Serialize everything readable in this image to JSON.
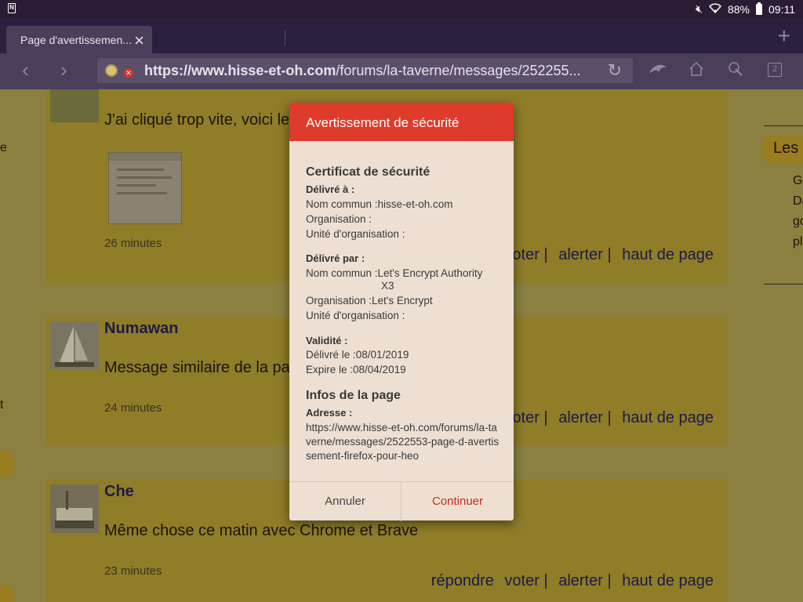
{
  "status_bar": {
    "battery": "88%",
    "time": "09:11"
  },
  "browser": {
    "tab_title": "Page d'avertissemen...",
    "url_bold": "https://www.hisse-et-oh.com",
    "url_rest": "/forums/la-taverne/messages/252255...",
    "tab_count": "2"
  },
  "posts": [
    {
      "author": "",
      "message": "J'ai cliqué trop vite, voici le",
      "time": "26 minutes",
      "actions": [
        "voter |",
        "alerter |",
        "haut de page"
      ]
    },
    {
      "author": "Numawan",
      "message": "Message similaire de la pa",
      "time": "24 minutes",
      "actions": [
        "voter |",
        "alerter |",
        "haut de page"
      ]
    },
    {
      "author": "Che",
      "message": "Même chose ce matin avec Chrome et Brave",
      "time": "23 minutes",
      "actions": [
        "répondre",
        "voter |",
        "alerter |",
        "haut de page"
      ]
    }
  ],
  "sidebar": {
    "heading": "Les",
    "lines": [
      "G",
      "Da",
      "go",
      "pl"
    ]
  },
  "left_stub": {
    "letter_1": "e",
    "letter_2": "t"
  },
  "dialog": {
    "title": "Avertissement de sécurité",
    "certificate_title": "Certificat de sécurité",
    "issued_to_label": "Délivré à :",
    "issued_to": {
      "common_name": "Nom commun :hisse-et-oh.com",
      "organisation": "Organisation :",
      "unit": "Unité d'organisation :"
    },
    "issued_by_label": "Délivré par :",
    "issued_by": {
      "common_name": "Nom commun :Let's Encrypt Authority",
      "common_name_cont": "X3",
      "organisation": "Organisation :Let's Encrypt",
      "unit": "Unité d'organisation :"
    },
    "validity_label": "Validité :",
    "validity": {
      "issued": "Délivré le :08/01/2019",
      "expires": "Expire le :08/04/2019"
    },
    "page_info_title": "Infos de la page",
    "address_label": "Adresse :",
    "address": "https://www.hisse-et-oh.com/forums/la-taverne/messages/2522553-page-d-avertissement-firefox-pour-heo",
    "cancel_label": "Annuler",
    "continue_label": "Continuer"
  }
}
